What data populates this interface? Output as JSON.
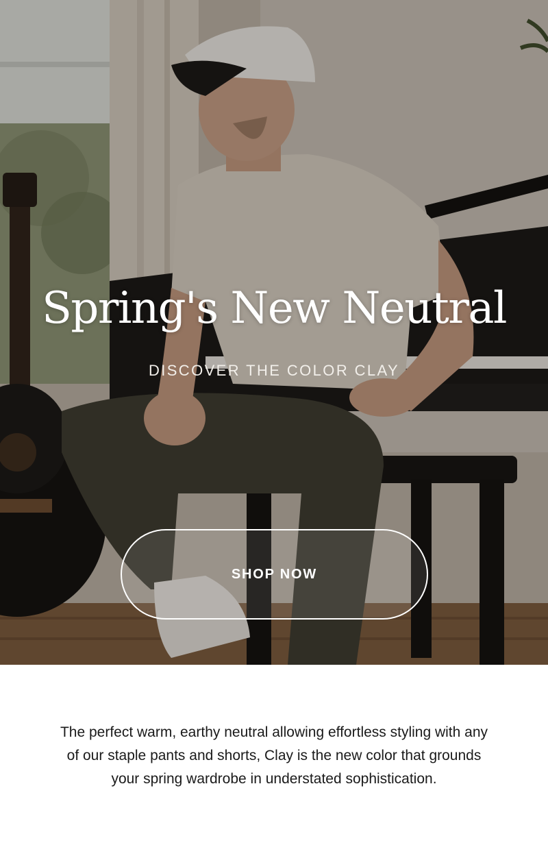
{
  "hero": {
    "image_alt": "Man in white cap and clay t-shirt seated on piano bench beside acoustic guitar",
    "title": "Spring's New Neutral",
    "subtitle": "DISCOVER THE COLOR CLAY",
    "cta_label": "SHOP NOW"
  },
  "content": {
    "description": "The perfect warm, earthy neutral allowing effortless styling with any of our staple pants and shorts, Clay is the new color that grounds your spring wardrobe in understated sophistication."
  },
  "colors": {
    "title_text": "#ffffff",
    "body_text": "#1a1a1a",
    "background": "#ffffff"
  }
}
